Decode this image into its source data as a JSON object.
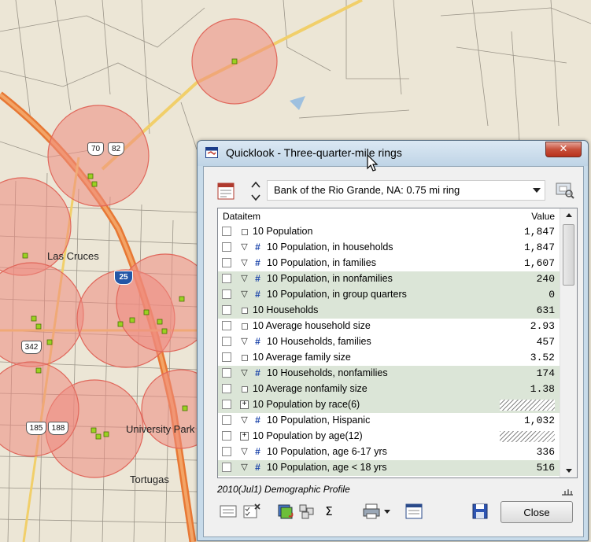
{
  "map": {
    "labels": {
      "las_cruces": "Las Cruces",
      "university_park": "University Park",
      "tortugas": "Tortugas"
    },
    "shields": {
      "us70": "70",
      "us82": "82",
      "i25": "25",
      "r342": "342",
      "r185": "185",
      "r188": "188"
    }
  },
  "window": {
    "title": "Quicklook - Three-quarter-mile rings",
    "close_glyph": "✕",
    "selector_value": "Bank of the Rio Grande, NA: 0.75 mi ring",
    "grid": {
      "header": {
        "name": "Dataitem",
        "value": "Value"
      },
      "rows": [
        {
          "label": "10 Population",
          "value": "1,847"
        },
        {
          "label": "10 Population, in households",
          "value": "1,847"
        },
        {
          "label": "10 Population, in families",
          "value": "1,607"
        },
        {
          "label": "10 Population, in nonfamilies",
          "value": "240"
        },
        {
          "label": "10 Population, in group quarters",
          "value": "0"
        },
        {
          "label": "10 Households",
          "value": "631"
        },
        {
          "label": "10 Average household size",
          "value": "2.93"
        },
        {
          "label": "10 Households, families",
          "value": "457"
        },
        {
          "label": "10 Average family size",
          "value": "3.52"
        },
        {
          "label": "10 Households, nonfamilies",
          "value": "174"
        },
        {
          "label": "10 Average nonfamily size",
          "value": "1.38"
        },
        {
          "label": "10 Population by race(6)",
          "value": ""
        },
        {
          "label": "10 Population, Hispanic",
          "value": "1,032"
        },
        {
          "label": "10 Population by age(12)",
          "value": ""
        },
        {
          "label": "10 Population, age 6-17 yrs",
          "value": "336"
        },
        {
          "label": "10 Population, age < 18 yrs",
          "value": "516"
        }
      ]
    },
    "profile_label": "2010(Jul1) Demographic Profile",
    "close_button": "Close",
    "toolbar_sigma": "Σ"
  }
}
